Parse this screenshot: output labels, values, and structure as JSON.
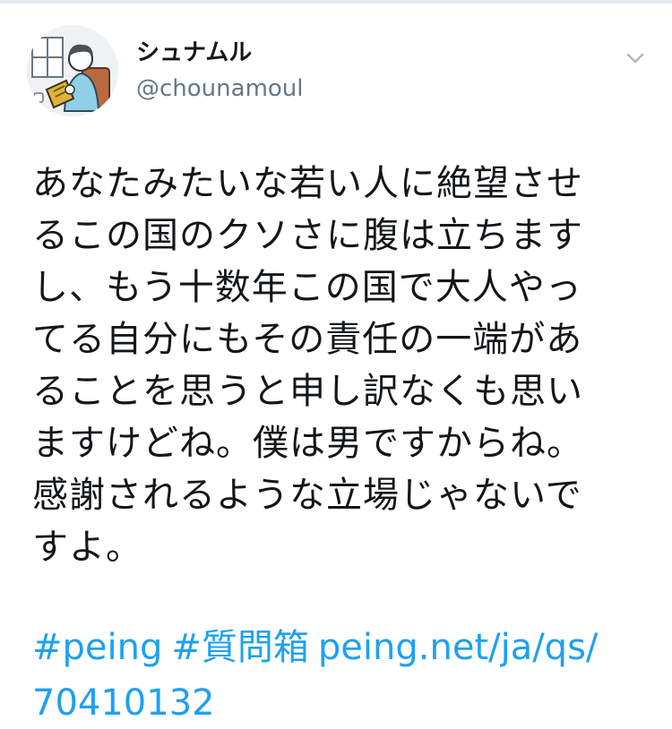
{
  "tweet": {
    "author": {
      "display_name": "シュナムル",
      "handle": "@chounamoul",
      "avatar_icon": "avatar-illustration-person-reading"
    },
    "menu_icon": "chevron-down-icon",
    "body_lines": [
      "あなたみたいな若い人に絶望させ",
      "るこの国のクソさに腹は立ちます",
      "し、もう十数年この国で大人やっ",
      "てる自分にもその責任の一端があ",
      "ることを思うと申し訳なくも思い",
      "ますけどね。僕は男ですからね。",
      "感謝されるような立場じゃないで",
      "すよ。"
    ],
    "hashtag_1": "#peing",
    "hashtag_2": "#質問箱",
    "link_part_1": "peing.net/ja/qs/",
    "link_part_2": "70410132"
  },
  "colors": {
    "text": "#14171a",
    "secondary": "#657786",
    "link": "#1da1f2",
    "divider": "#e6ecf0"
  }
}
